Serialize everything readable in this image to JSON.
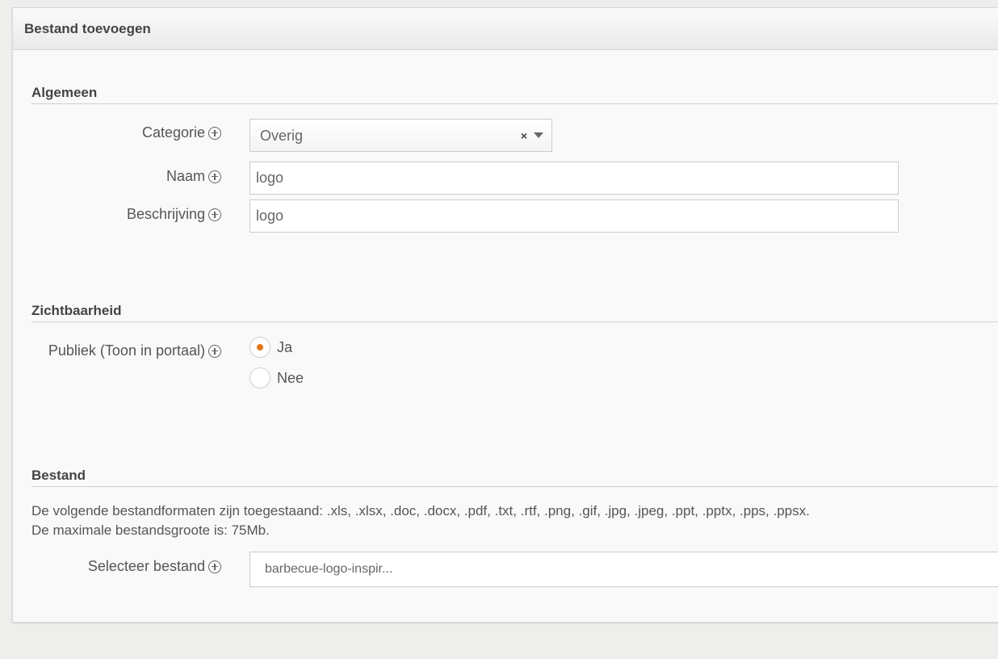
{
  "panel": {
    "title": "Bestand toevoegen"
  },
  "sections": {
    "general": {
      "title": "Algemeen",
      "category": {
        "label": "Categorie",
        "value": "Overig",
        "clear": "×"
      },
      "name": {
        "label": "Naam",
        "value": "logo"
      },
      "description": {
        "label": "Beschrijving",
        "value": "logo"
      }
    },
    "visibility": {
      "title": "Zichtbaarheid",
      "public": {
        "label": "Publiek (Toon in portaal)",
        "options": [
          "Ja",
          "Nee"
        ],
        "selected": "Ja"
      }
    },
    "file": {
      "title": "Bestand",
      "allowed_formats": "De volgende bestandformaten zijn toegestaand: .xls, .xlsx, .doc, .docx, .pdf, .txt, .rtf, .png, .gif, .jpg, .jpeg, .ppt, .pptx, .pps, .ppsx.",
      "max_size": "De maximale bestandsgroote is: 75Mb.",
      "select": {
        "label": "Selecteer bestand",
        "value": "barbecue-logo-inspir..."
      }
    }
  },
  "colors": {
    "accent": "#e07617",
    "background": "#eeeeec",
    "panel": "#f9f9f9"
  },
  "icons": {
    "help": "plus-circle-icon",
    "dropdown": "chevron-down-icon"
  }
}
